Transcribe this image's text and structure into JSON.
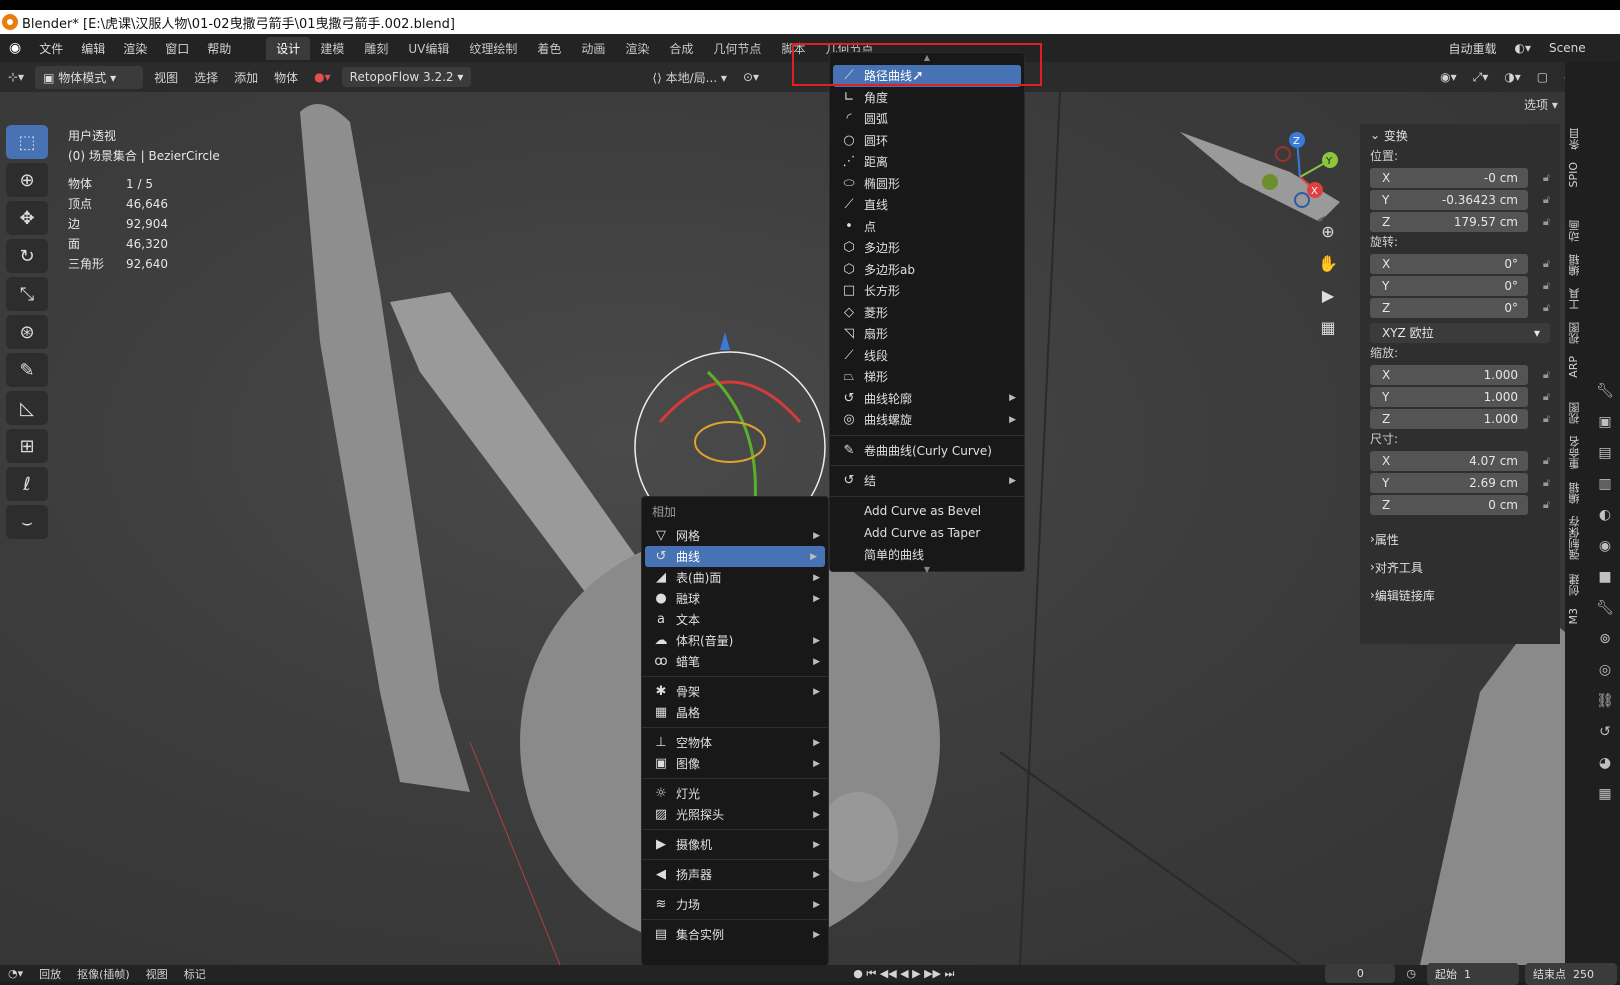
{
  "titlebar": {
    "text": "Blender* [E:\\虎课\\汉服人物\\01-02曳撒弓箭手\\01曳撒弓箭手.002.blend]"
  },
  "menubar": {
    "menus": [
      "文件",
      "编辑",
      "渲染",
      "窗口",
      "帮助"
    ],
    "workspaces": [
      "设计",
      "建模",
      "雕刻",
      "UV编辑",
      "纹理绘制",
      "着色",
      "动画",
      "渲染",
      "合成",
      "几何节点",
      "脚本",
      "几何节点"
    ],
    "right_label": "自动重载",
    "scene": "Scene"
  },
  "header": {
    "mode": "物体模式",
    "items": [
      "视图",
      "选择",
      "添加",
      "物体"
    ],
    "addon": "RetopoFlow 3.2.2",
    "transform": "本地/局...",
    "options": "选项"
  },
  "overlay": {
    "view": "用户透视",
    "collection": "(0) 场景集合 | BezierCircle",
    "stats": [
      {
        "label": "物体",
        "value": "1 / 5"
      },
      {
        "label": "顶点",
        "value": "46,646"
      },
      {
        "label": "边",
        "value": "92,904"
      },
      {
        "label": "面",
        "value": "46,320"
      },
      {
        "label": "三角形",
        "value": "92,640"
      }
    ]
  },
  "npanel": {
    "transform_title": "变换",
    "location_label": "位置:",
    "location": [
      {
        "axis": "X",
        "value": "-0 cm"
      },
      {
        "axis": "Y",
        "value": "-0.36423 cm"
      },
      {
        "axis": "Z",
        "value": "179.57 cm"
      }
    ],
    "rotation_label": "旋转:",
    "rotation": [
      {
        "axis": "X",
        "value": "0°"
      },
      {
        "axis": "Y",
        "value": "0°"
      },
      {
        "axis": "Z",
        "value": "0°"
      }
    ],
    "rotation_mode": "XYZ 欧拉",
    "scale_label": "缩放:",
    "scale": [
      {
        "axis": "X",
        "value": "1.000"
      },
      {
        "axis": "Y",
        "value": "1.000"
      },
      {
        "axis": "Z",
        "value": "1.000"
      }
    ],
    "dimensions_label": "尺寸:",
    "dimensions": [
      {
        "axis": "X",
        "value": "4.07 cm"
      },
      {
        "axis": "Y",
        "value": "2.69 cm"
      },
      {
        "axis": "Z",
        "value": "0 cm"
      }
    ],
    "sections": [
      "属性",
      "对齐工具",
      "编辑链接库"
    ]
  },
  "vtabs": [
    "条目",
    "SPIO",
    "动画",
    "编辑",
    "工具",
    "视图",
    "ARP",
    "视图",
    "重命名",
    "编辑",
    "强制保存",
    "创建",
    "M3"
  ],
  "addmenu": {
    "title": "相加",
    "items": [
      {
        "label": "网格",
        "icon": "▽",
        "sub": true
      },
      {
        "label": "曲线",
        "icon": "↺",
        "sub": true,
        "hl": true
      },
      {
        "label": "表(曲)面",
        "icon": "◢",
        "sub": true
      },
      {
        "label": "融球",
        "icon": "●",
        "sub": true
      },
      {
        "label": "文本",
        "icon": "a",
        "sub": false
      },
      {
        "label": "体积(音量)",
        "icon": "☁",
        "sub": true
      },
      {
        "label": "蜡笔",
        "icon": "ꝏ",
        "sub": true
      },
      {
        "sep": true
      },
      {
        "label": "骨架",
        "icon": "✱",
        "sub": true
      },
      {
        "label": "晶格",
        "icon": "▦",
        "sub": false
      },
      {
        "sep": true
      },
      {
        "label": "空物体",
        "icon": "⊥",
        "sub": true
      },
      {
        "label": "图像",
        "icon": "▣",
        "sub": true
      },
      {
        "sep": true
      },
      {
        "label": "灯光",
        "icon": "☼",
        "sub": true
      },
      {
        "label": "光照探头",
        "icon": "▨",
        "sub": true
      },
      {
        "sep": true
      },
      {
        "label": "摄像机",
        "icon": "▶",
        "sub": true
      },
      {
        "sep": true
      },
      {
        "label": "扬声器",
        "icon": "◀",
        "sub": true
      },
      {
        "sep": true
      },
      {
        "label": "力场",
        "icon": "≋",
        "sub": true
      },
      {
        "sep": true
      },
      {
        "label": "集合实例",
        "icon": "▤",
        "sub": true
      }
    ]
  },
  "submenu": {
    "items": [
      {
        "label": "路径曲线",
        "icon": "⟋",
        "hl": true
      },
      {
        "label": "角度",
        "icon": "∟"
      },
      {
        "label": "圆弧",
        "icon": "◜"
      },
      {
        "label": "圆环",
        "icon": "○"
      },
      {
        "label": "距离",
        "icon": "⋰"
      },
      {
        "label": "椭圆形",
        "icon": "⬭"
      },
      {
        "label": "直线",
        "icon": "⟋"
      },
      {
        "label": "点",
        "icon": "•"
      },
      {
        "label": "多边形",
        "icon": "⬡"
      },
      {
        "label": "多边形ab",
        "icon": "⬡"
      },
      {
        "label": "长方形",
        "icon": "□"
      },
      {
        "label": "菱形",
        "icon": "◇"
      },
      {
        "label": "扇形",
        "icon": "◹"
      },
      {
        "label": "线段",
        "icon": "⟋"
      },
      {
        "label": "梯形",
        "icon": "⏢"
      },
      {
        "label": "曲线轮廓",
        "icon": "↺",
        "sub": true
      },
      {
        "label": "曲线螺旋",
        "icon": "◎",
        "sub": true
      },
      {
        "sep": true
      },
      {
        "label": "卷曲曲线(Curly Curve)",
        "icon": "✎"
      },
      {
        "sep": true
      },
      {
        "label": "结",
        "icon": "↺",
        "sub": true
      },
      {
        "sep": true
      },
      {
        "label": "Add Curve as Bevel",
        "icon": ""
      },
      {
        "label": "Add Curve as Taper",
        "icon": ""
      },
      {
        "label": "简单的曲线",
        "icon": ""
      }
    ]
  },
  "timeline": {
    "items": [
      "回放",
      "抠像(插帧)",
      "视图",
      "标记"
    ],
    "frame": "0",
    "start_label": "起始",
    "start": "1",
    "end_label": "结束点",
    "end": "250"
  }
}
